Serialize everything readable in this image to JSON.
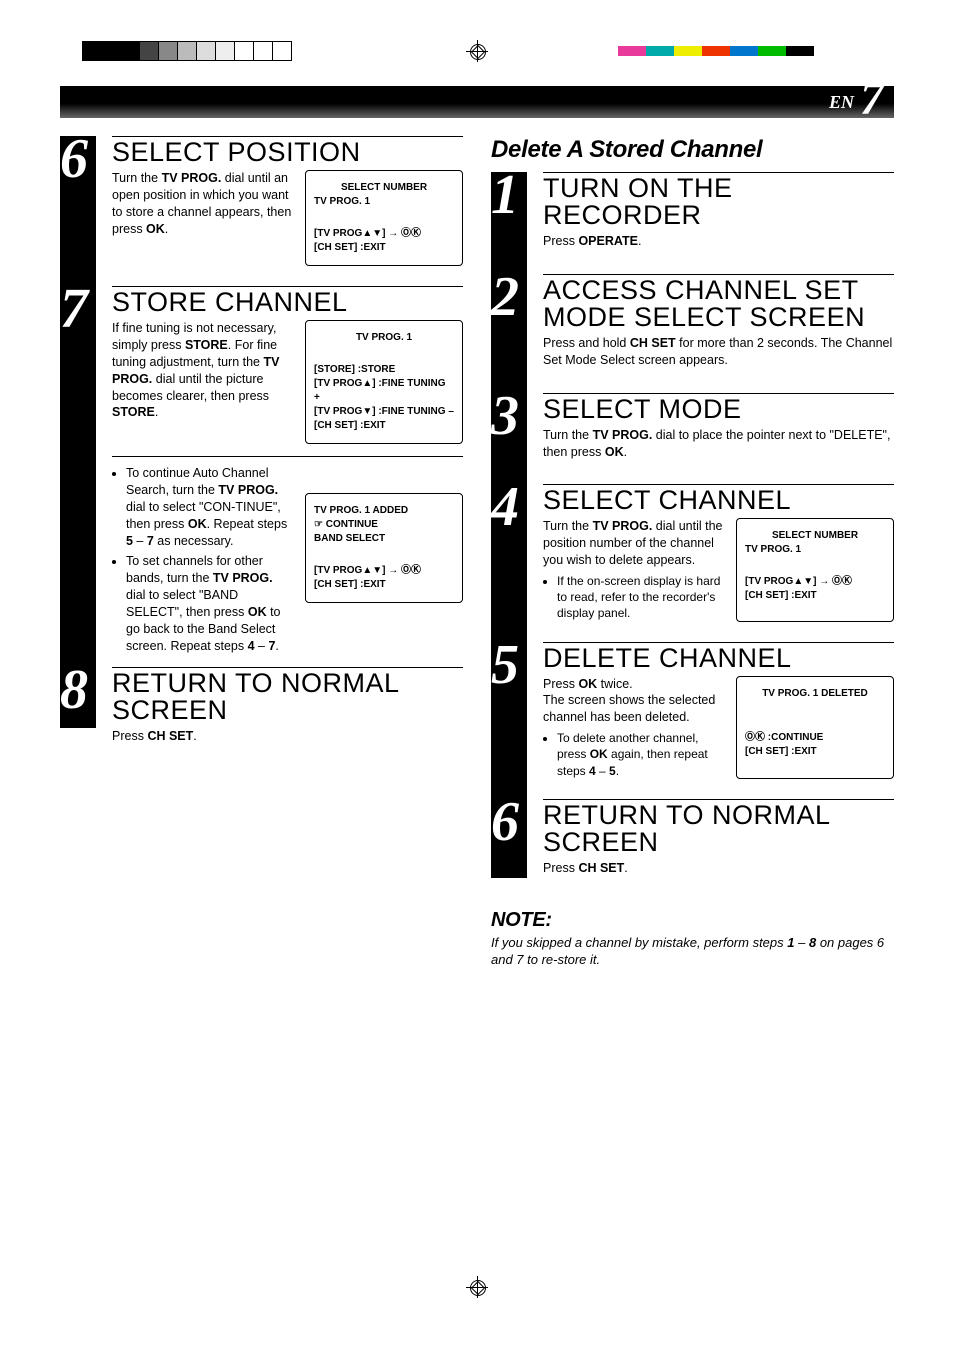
{
  "page": {
    "lang": "EN",
    "number": "7"
  },
  "left": {
    "step6": {
      "title": "SELECT POSITION",
      "body": "Turn the <b>TV PROG.</b> dial until an open position in which you want to store a channel appears, then press <b>OK</b>.",
      "osd_l1": "SELECT NUMBER",
      "osd_l2": "TV PROG.    1",
      "osd_b1": "[TV PROG▲▼] → ⓄⓀ",
      "osd_b2": "[CH SET] :EXIT"
    },
    "step7": {
      "title": "STORE CHANNEL",
      "body": "If fine tuning is not necessary, simply press <b>STORE</b>. For fine tuning adjustment, turn the <b>TV PROG.</b> dial until the picture becomes clearer, then press <b>STORE</b>.",
      "osd_l1": "TV PROG.    1",
      "osd_b1": "[STORE] :STORE",
      "osd_b2": "[TV PROG▲] :FINE TUNING +",
      "osd_b3": "[TV PROG▼] :FINE TUNING –",
      "osd_b4": "[CH SET] :EXIT"
    },
    "bullets": {
      "b1": "To continue Auto Channel Search, turn the <b>TV PROG.</b> dial to select \"CON-TINUE\", then press <b>OK</b>. Repeat steps <b>5</b> – <b>7</b> as necessary.",
      "b2": "To set channels for other bands, turn the <b>TV PROG.</b> dial to select \"BAND SELECT\", then press <b>OK</b> to go back to the Band Select screen. Repeat steps <b>4</b> – <b>7</b>.",
      "osd_l1": "TV PROG.    1    ADDED",
      "osd_l2": "☞ CONTINUE",
      "osd_l3": "    BAND SELECT",
      "osd_b1": "[TV PROG▲▼] → ⓄⓀ",
      "osd_b2": "[CH SET] :EXIT"
    },
    "step8": {
      "title": "RETURN TO NORMAL SCREEN",
      "body": "Press <b>CH SET</b>."
    }
  },
  "right": {
    "heading": "Delete A Stored Channel",
    "step1": {
      "title": "TURN ON THE RECORDER",
      "body": "Press <b>OPERATE</b>."
    },
    "step2": {
      "title": "ACCESS CHANNEL SET MODE SELECT SCREEN",
      "body": "Press and hold <b>CH SET</b> for more than 2 seconds. The Channel Set Mode Select screen appears."
    },
    "step3": {
      "title": "SELECT MODE",
      "body": "Turn the <b>TV PROG.</b> dial to place the pointer next to \"DELETE\", then press <b>OK</b>."
    },
    "step4": {
      "title": "SELECT CHANNEL",
      "body": "Turn the <b>TV PROG.</b> dial until the position number of the channel you wish to delete  appears.",
      "bullet": "If the on-screen display is hard to read, refer to the recorder's display panel.",
      "osd_l1": "SELECT NUMBER",
      "osd_l2": "TV PROG.    1",
      "osd_b1": "[TV PROG▲▼] → ⓄⓀ",
      "osd_b2": "[CH SET] :EXIT"
    },
    "step5": {
      "title": "DELETE CHANNEL",
      "body": "Press <b>OK</b> twice.<br>The screen shows the selected channel has been deleted.",
      "bullet": "To delete another channel, press <b>OK</b> again, then repeat steps <b>4</b> – <b>5</b>.",
      "osd_l1": "TV PROG.    1  DELETED",
      "osd_b1": "ⓄⓀ :CONTINUE",
      "osd_b2": "[CH SET] :EXIT"
    },
    "step6": {
      "title": "RETURN TO NORMAL SCREEN",
      "body": "Press <b>CH SET</b>."
    }
  },
  "note": {
    "heading": "NOTE:",
    "body": "If you skipped a channel by mistake, perform steps <b>1</b> – <b>8</b> on pages 6 and 7 to re-store it."
  }
}
